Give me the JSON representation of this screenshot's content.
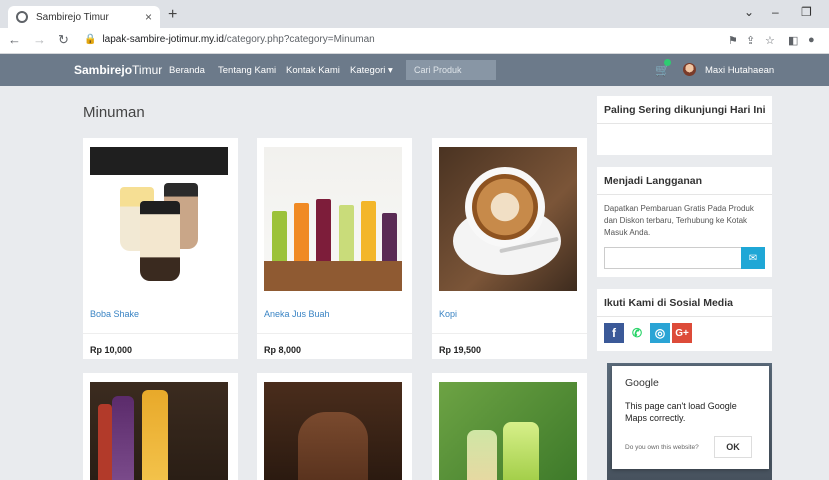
{
  "browser": {
    "tab_title": "Sambirejo Timur",
    "tab_close": "×",
    "new_tab": "+",
    "url_domain": "lapak-sambire-jotimur.my.id",
    "url_path": "/category.php?category=Minuman"
  },
  "navbar": {
    "brand_bold": "Sambirejo",
    "brand_rest": "Timur",
    "links": [
      "Beranda",
      "Tentang Kami",
      "Kontak Kami",
      "Kategori ▾"
    ],
    "search_placeholder": "Cari Produk",
    "user_name": "Maxi Hutahaean"
  },
  "main": {
    "title": "Minuman",
    "products": [
      {
        "name": "Boba Shake",
        "price": "Rp 10,000"
      },
      {
        "name": "Aneka Jus Buah",
        "price": "Rp 8,000"
      },
      {
        "name": "Kopi",
        "price": "Rp 19,500"
      }
    ]
  },
  "sidebar": {
    "popular_title": "Paling Sering dikunjungi Hari Ini",
    "subscribe_title": "Menjadi Langganan",
    "subscribe_text": "Dapatkan Pembaruan Gratis Pada Produk dan Diskon terbaru, Terhubung ke Kotak Masuk Anda.",
    "social_title": "Ikuti Kami di Sosial Media",
    "social": [
      {
        "icon": "facebook-icon",
        "glyph": "f",
        "color": "#3b5998"
      },
      {
        "icon": "whatsapp-icon",
        "glyph": "✆",
        "color": "#25d366"
      },
      {
        "icon": "instagram-icon",
        "glyph": "◎",
        "color": "#2aa4d5"
      },
      {
        "icon": "google-plus-icon",
        "glyph": "G+",
        "color": "#dd4b39"
      }
    ]
  },
  "map_error": {
    "title": "Google",
    "message": "This page can't load Google Maps correctly.",
    "own_prompt": "Do you own this website?",
    "ok": "OK"
  }
}
